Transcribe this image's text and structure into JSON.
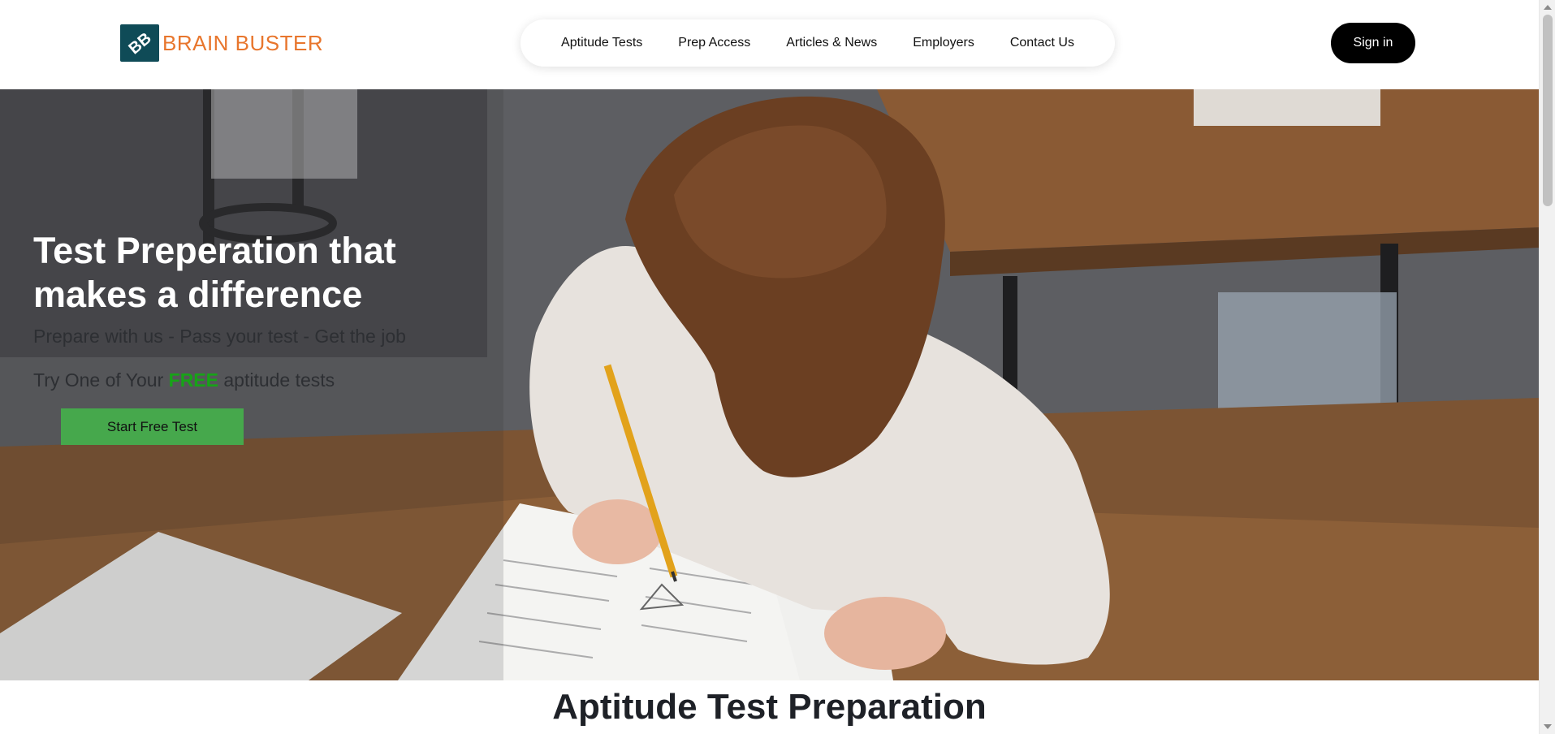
{
  "brand": {
    "name": "BRAIN BUSTER",
    "mark_text": "BB",
    "mark_color": "#0f4b57",
    "name_color": "#e8762d"
  },
  "nav": {
    "items": [
      {
        "label": "Aptitude Tests"
      },
      {
        "label": "Prep Access"
      },
      {
        "label": "Articles & News"
      },
      {
        "label": "Employers"
      },
      {
        "label": "Contact Us"
      }
    ],
    "signin_label": "Sign in"
  },
  "hero": {
    "title": "Test Preperation that makes a difference",
    "subtitle": "Prepare with us - Pass your test - Get the job",
    "free_prefix": "Try One of Your ",
    "free_word": "FREE",
    "free_suffix": " aptitude tests",
    "cta_label": "Start Free Test",
    "cta_color": "#46a84c",
    "free_color": "#17a317",
    "image_icon": "student-writing-test-photo"
  },
  "section": {
    "title": "Aptitude Test Preparation"
  }
}
